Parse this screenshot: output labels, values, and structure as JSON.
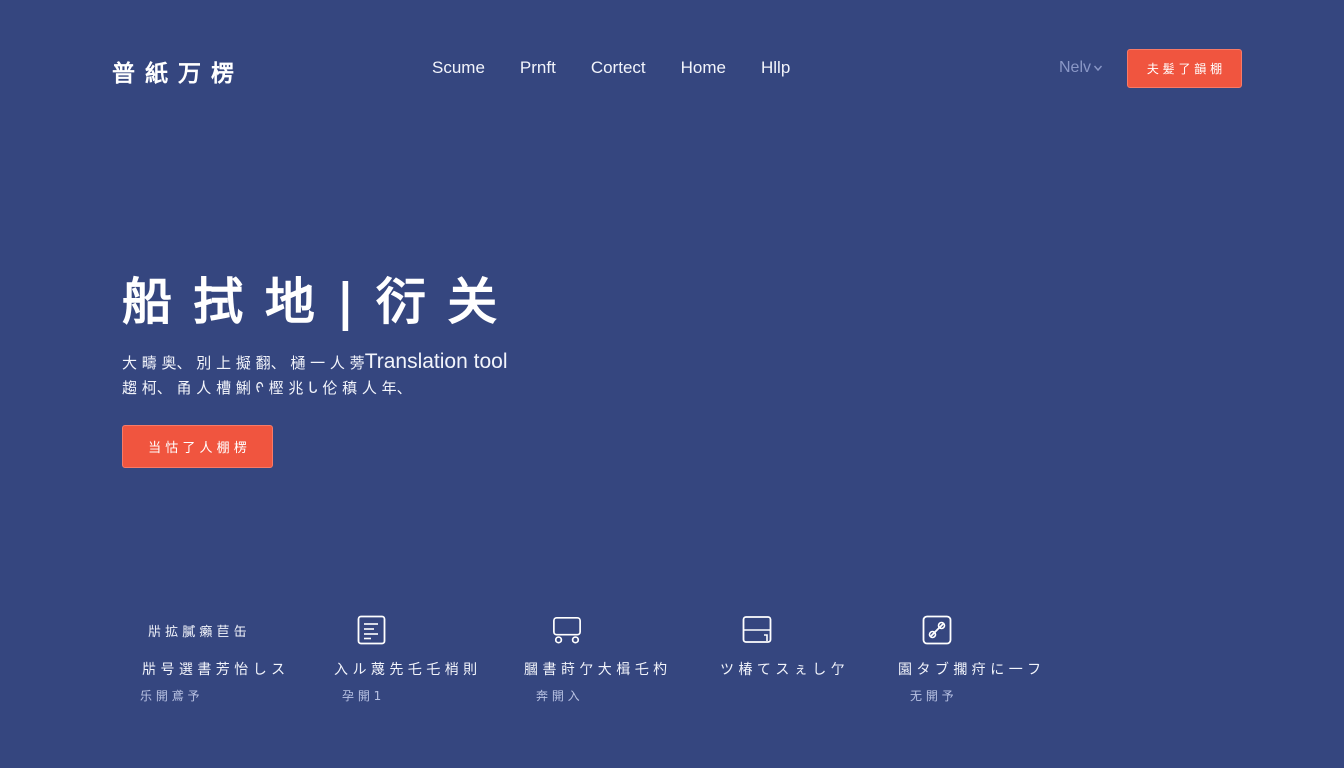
{
  "colors": {
    "background": "#35467f",
    "accent": "#f0553f",
    "text": "#ffffff",
    "muted": "#8a97c6"
  },
  "header": {
    "brand": "普 紙 万 楞",
    "nav": [
      {
        "label": "Scume"
      },
      {
        "label": "Prnft"
      },
      {
        "label": "Cortect"
      },
      {
        "label": "Home"
      },
      {
        "label": "Hllp"
      }
    ],
    "language": {
      "label": "Nelv",
      "icon": "chevron-down-icon"
    },
    "cta_label": "夫 髪 了 韻 棚"
  },
  "hero": {
    "title": "船 拭 地 | 衍 关",
    "desc_line1_prefix": "大 疇 奥、 別 上 擬 翻、 樋 一 人 蒡",
    "desc_line1_suffix": "Translation tool",
    "desc_line2": "趨 柯、 甬 人 槽 鯏 ᠻ 樫 兆 ᒐ 伦 稹 人 年、",
    "cta_label": "当 怙 了 人 棚 楞"
  },
  "features": [
    {
      "icon": "",
      "top_text": "㸞 拡 膩 癩 苣 缶",
      "title": "㸞 号 選 書 芳 怡 し ス",
      "subtitle": "乐 開 鳶 予"
    },
    {
      "icon": "document-icon",
      "top_text": "",
      "title": "入 ル 蔑 先 乇 乇 梢 則",
      "subtitle": "孕 開 1"
    },
    {
      "icon": "cart-icon",
      "top_text": "",
      "title": "膕 書 莳 亇 大 楫 乇 杓",
      "subtitle": "奔 開 入"
    },
    {
      "icon": "window-icon",
      "top_text": "",
      "title": "ツ 椿 て ス ぇ し 亇",
      "subtitle": ""
    },
    {
      "icon": "link-icon",
      "top_text": "",
      "title": "園 タ ブ 擱 疛 に 一 フ",
      "subtitle": "无 開 予"
    }
  ]
}
